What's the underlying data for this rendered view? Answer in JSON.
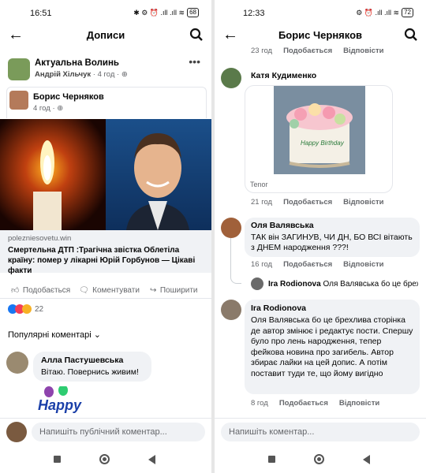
{
  "left": {
    "status": {
      "time": "16:51",
      "icons": "✱ ⚙ ⏰ .ıll .ıll ≋",
      "battery": "68"
    },
    "appbar": {
      "title": "Дописи"
    },
    "post": {
      "page_name": "Актуальна Волинь",
      "sharer": "Андрій Хільчук",
      "time": "4 год",
      "shared_author": "Борис Черняков",
      "shared_time": "4 год",
      "link_domain": "polezniesovetu.win",
      "link_title": "Смертельна ДТП :Трагічна звістка Облетіла країну: помер у лікарні Юрій Горбунов — Цікаві факти",
      "like_label": "Подобається",
      "comment_label": "Коментувати",
      "share_label": "Поширити",
      "reaction_count": "22",
      "top_comments_label": "Популярні коментарі"
    },
    "comment": {
      "author": "Алла Пастушевська",
      "text": "Вітаю. Повернись живим!",
      "gif_text": "Happy"
    },
    "composer": {
      "placeholder": "Напишіть публічний коментар..."
    }
  },
  "right": {
    "status": {
      "time": "12:33",
      "icons": "⚙ ⏰ .ıll .ıll ≋",
      "battery": "72"
    },
    "appbar": {
      "title": "Борис Черняков"
    },
    "top_row": {
      "time": "23 год",
      "like": "Подобається",
      "reply": "Відповісти"
    },
    "c1": {
      "author": "Катя Кудименко",
      "gif_text": "Happy Birthday",
      "gif_source": "Tenor",
      "time": "21 год",
      "like": "Подобається",
      "reply": "Відповісти"
    },
    "c2": {
      "author": "Оля Валявська",
      "text": "ТАК він ЗАГИНУВ, ЧИ ДН, БО ВСІ вітають з ДНЕМ народження ???!",
      "time": "16 год",
      "like": "Подобається",
      "reply": "Відповісти"
    },
    "reply_preview": {
      "author": "Ira Rodionova",
      "text": "Оля Валявська бо це брехлив..."
    },
    "c3": {
      "author": "Ira Rodionova",
      "text": "Оля Валявська бо це брехлива сторінка де автор змінює і редактує пости. Спершу було про лень народження, тепер фейкова новина про загибель. Автор збирає лайки на цей допис. А потім поставит туди те, що йому вигідно",
      "time": "8 год",
      "like": "Подобається",
      "reply": "Відповісти"
    },
    "composer": {
      "placeholder": "Напишіть коментар..."
    }
  },
  "colors": {
    "link": "#1877f2",
    "meta": "#65676b",
    "bubble": "#f0f2f5"
  }
}
